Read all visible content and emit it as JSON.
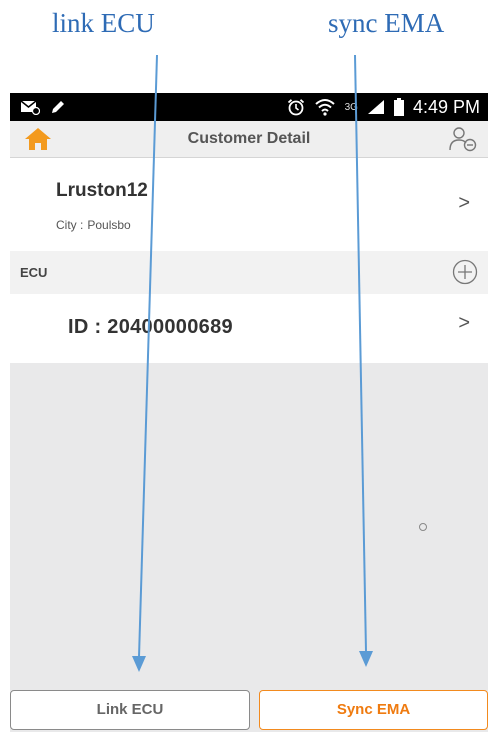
{
  "annotations": {
    "left_label": "link ECU",
    "right_label": "sync EMA"
  },
  "status_bar": {
    "network": "3G",
    "time": "4:49 PM",
    "icons": [
      "email-icon",
      "edit-icon",
      "alarm-icon",
      "wifi-icon",
      "signal-icon",
      "battery-icon"
    ]
  },
  "app_bar": {
    "title": "Customer Detail",
    "left_icon": "home-icon",
    "right_icon": "user-remove-icon",
    "home_color": "#f39a1e"
  },
  "customer": {
    "name": "Lruston12",
    "city_label": "City :",
    "city": "Poulsbo",
    "chevron": ">"
  },
  "ecu_section": {
    "title": "ECU",
    "add_icon": "plus-circle-icon",
    "items": [
      {
        "label": "ID : 20400000689",
        "chevron": ">"
      }
    ]
  },
  "buttons": {
    "link_ecu": "Link ECU",
    "sync_ema": "Sync EMA"
  },
  "colors": {
    "accent_orange": "#ef7b10",
    "annotation_blue": "#2e6bb5",
    "arrow_blue": "#5b9bd5"
  }
}
